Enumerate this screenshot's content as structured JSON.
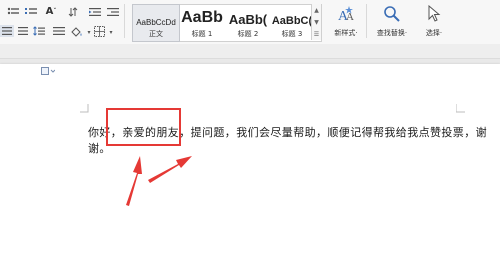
{
  "ribbon": {
    "styles": [
      {
        "preview": "AaBbCcDd",
        "label": "正文",
        "selected": true
      },
      {
        "preview": "AaBb",
        "label": "标题 1",
        "selected": false
      },
      {
        "preview": "AaBb(",
        "label": "标题 2",
        "selected": false
      },
      {
        "preview": "AaBbC(",
        "label": "标题 3",
        "selected": false
      }
    ],
    "new_style_label": "新样式·",
    "find_replace_label": "查找替换·",
    "select_label": "选择·"
  },
  "document": {
    "line1": "你好，亲爱的朋友，提问题，我们会尽量帮助，顺便记得帮我给我点赞投票，谢",
    "line2": "谢。"
  },
  "colors": {
    "annotation": "#e53935",
    "accent": "#2b5797"
  }
}
